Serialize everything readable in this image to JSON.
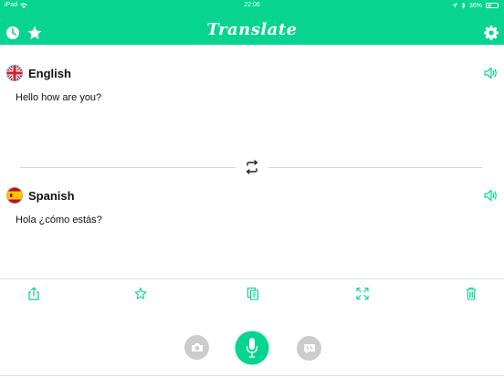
{
  "status_bar": {
    "device": "iPad",
    "time": "22:06",
    "battery": "36%",
    "battery_level": 0.36
  },
  "header": {
    "title": "Translate",
    "icons": [
      "history-icon",
      "favorites-star-icon",
      "settings-gear-icon"
    ]
  },
  "source": {
    "language": "English",
    "text": "Hello how are you?",
    "flag": "uk-flag-icon"
  },
  "target": {
    "language": "Spanish",
    "text": "Hola ¿cómo estás?",
    "flag": "spain-flag-icon"
  },
  "toolbar": {
    "icons": [
      "share-icon",
      "star-icon",
      "copy-icon",
      "fullscreen-icon",
      "trash-icon"
    ]
  },
  "bottom_controls": {
    "icons": [
      "camera-icon",
      "microphone-icon",
      "conversation-icon"
    ]
  },
  "colors": {
    "accent": "#07d48f",
    "mic_button": "#07d48f",
    "secondary_button": "#cccccc",
    "divider": "#d6d6d6"
  }
}
